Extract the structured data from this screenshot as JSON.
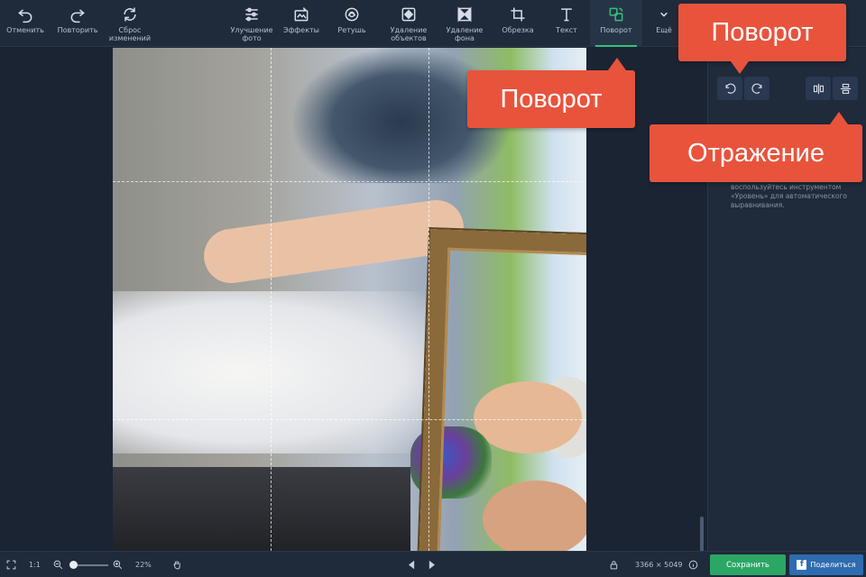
{
  "toolbar": {
    "items": [
      {
        "label": "Отменить",
        "icon": "undo-icon"
      },
      {
        "label": "Повторить",
        "icon": "redo-icon"
      },
      {
        "label": "Сброс\nизменений",
        "icon": "reset-icon"
      },
      {
        "label": "Улучшение\nфото",
        "icon": "sliders-icon"
      },
      {
        "label": "Эффекты",
        "icon": "effects-icon"
      },
      {
        "label": "Ретушь",
        "icon": "retouch-icon"
      },
      {
        "label": "Удаление\nобъектов",
        "icon": "object-removal-icon"
      },
      {
        "label": "Удаление\nфона",
        "icon": "background-removal-icon"
      },
      {
        "label": "Обрезка",
        "icon": "crop-icon"
      },
      {
        "label": "Текст",
        "icon": "text-icon"
      },
      {
        "label": "Поворот",
        "icon": "rotate-icon",
        "active": true
      },
      {
        "label": "Ещё",
        "icon": "chevron-down-icon"
      }
    ]
  },
  "callouts": {
    "rotate_top": "Поворот",
    "rotate_main": "Поворот",
    "mirror": "Отражение"
  },
  "panel": {
    "help_text": "воспользуйтесь инструментом «Уровень» для автоматического выравнивания."
  },
  "bottom": {
    "page": "1:1",
    "zoom": "22%",
    "dimensions": "3366 × 5049",
    "save_label": "Сохранить",
    "share_label": "Поделиться"
  },
  "colors": {
    "accent": "#35c07a",
    "save": "#2ba665",
    "share": "#2e6bb0",
    "callout": "#e8533c"
  }
}
